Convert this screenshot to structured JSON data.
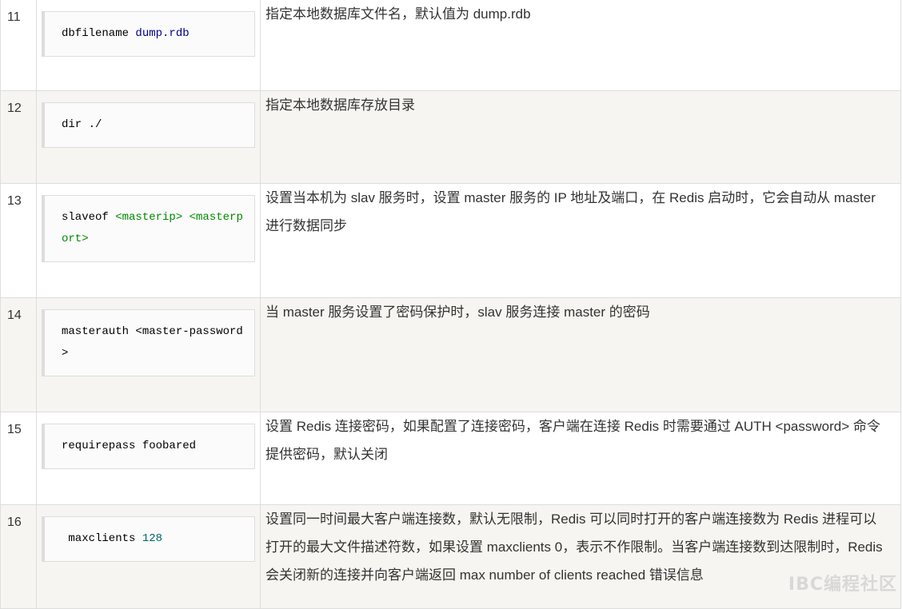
{
  "rows": [
    {
      "num": "11",
      "code": {
        "cmd": "dbfilename ",
        "arg": "dump.rdb",
        "arg_type": "str"
      },
      "desc": "指定本地数据库文件名，默认值为 dump.rdb",
      "alt": false
    },
    {
      "num": "12",
      "code": {
        "cmd": "dir ./",
        "arg": "",
        "arg_type": ""
      },
      "desc": "指定本地数据库存放目录",
      "alt": true
    },
    {
      "num": "13",
      "code": {
        "cmd": "slaveof ",
        "arg": "<masterip> <masterport>",
        "arg_type": "tag"
      },
      "desc": "设置当本机为 slav 服务时，设置 master 服务的 IP 地址及端口，在 Redis 启动时，它会自动从 master 进行数据同步",
      "alt": false
    },
    {
      "num": "14",
      "code": {
        "cmd": "masterauth <master-password>",
        "arg": "",
        "arg_type": ""
      },
      "desc": "当 master 服务设置了密码保护时，slav 服务连接 master 的密码",
      "alt": true
    },
    {
      "num": "15",
      "code": {
        "cmd": "requirepass foobared",
        "arg": "",
        "arg_type": ""
      },
      "desc": "设置 Redis 连接密码，如果配置了连接密码，客户端在连接 Redis 时需要通过 AUTH <password> 命令提供密码，默认关闭",
      "alt": false
    },
    {
      "num": "16",
      "code": {
        "cmd": " maxclients ",
        "arg": "128",
        "arg_type": "num"
      },
      "desc": "设置同一时间最大客户端连接数，默认无限制，Redis 可以同时打开的客户端连接数为 Redis 进程可以打开的最大文件描述符数，如果设置 maxclients 0，表示不作限制。当客户端连接数到达限制时，Redis 会关闭新的连接并向客户端返回 max number of clients reached 错误信息",
      "alt": true
    }
  ],
  "watermark": "IBC编程社区"
}
